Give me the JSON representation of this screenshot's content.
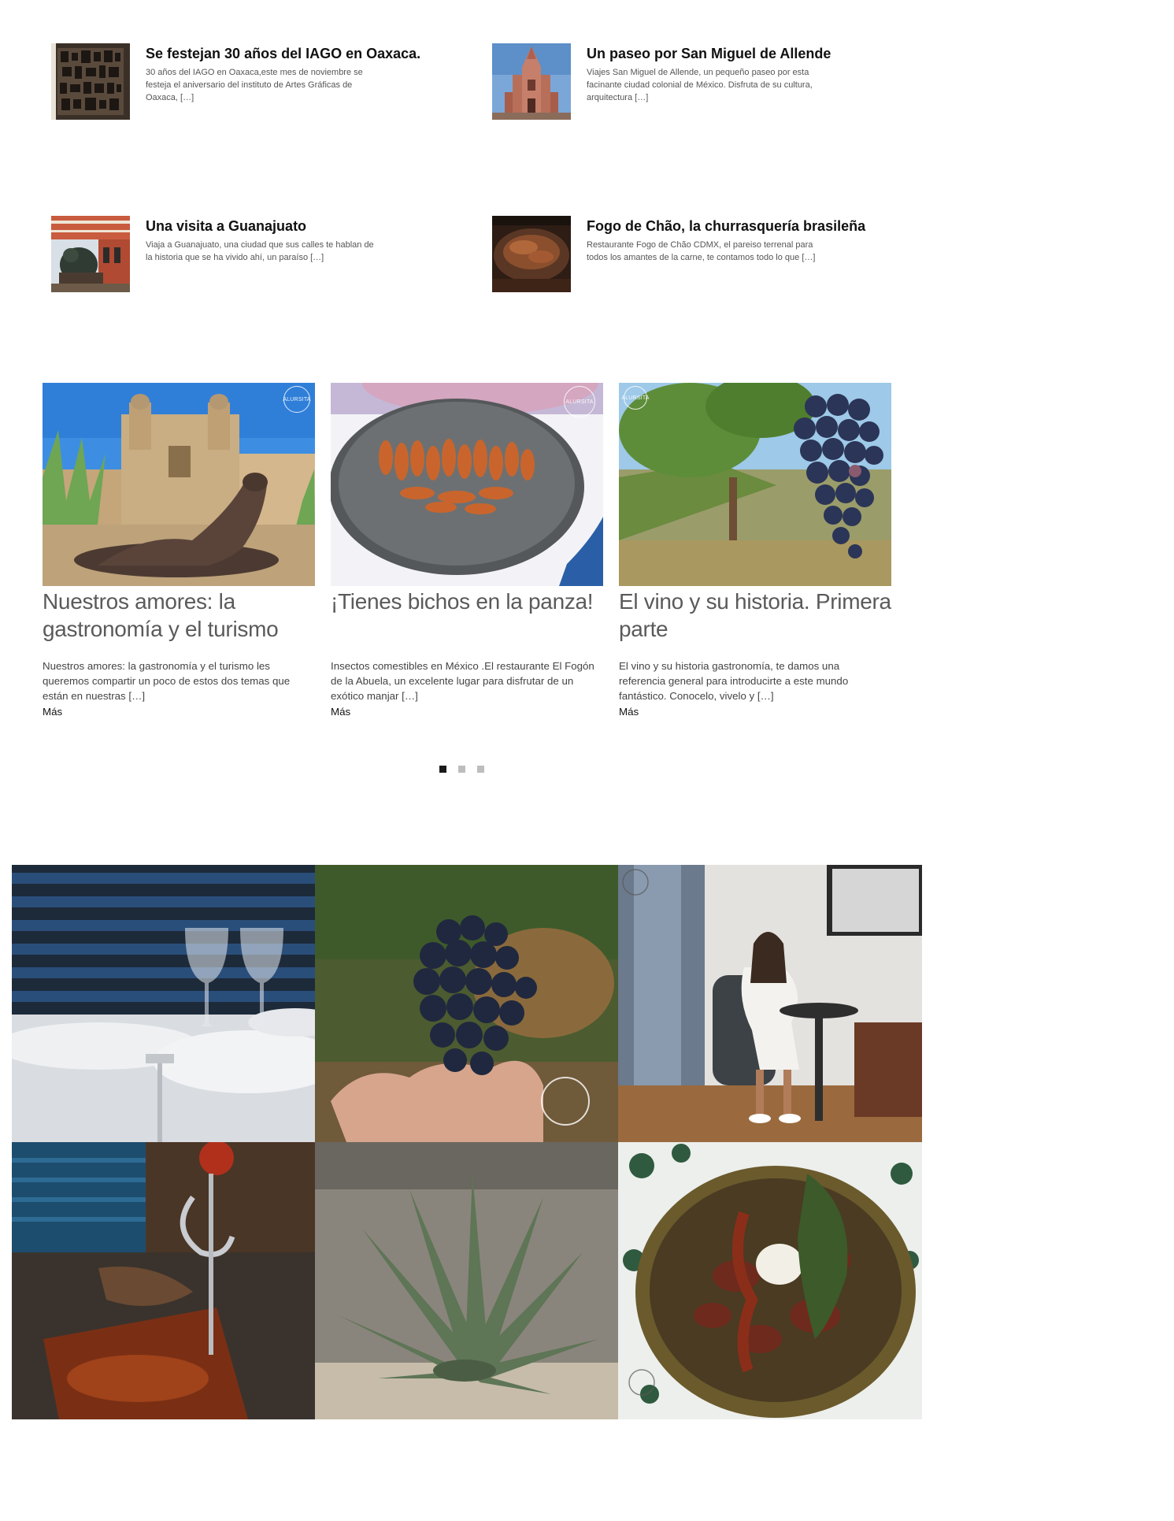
{
  "posts": [
    {
      "title": "Se festejan 30 años del IAGO en Oaxaca.",
      "excerpt": "30 años del IAGO en Oaxaca,este mes de noviembre se festeja el aniversario del instituto de Artes Gráficas de Oaxaca, […]"
    },
    {
      "title": "Un paseo por San Miguel de Allende",
      "excerpt": "Viajes San Miguel de Allende, un pequeño paseo por esta facinante ciudad colonial de México. Disfruta de su cultura, arquitectura […]"
    },
    {
      "title": "Una visita a Guanajuato",
      "excerpt": "Viaja a Guanajuato, una ciudad que sus calles te hablan de la historia que se ha vivido ahí, un paraíso […]"
    },
    {
      "title": "Fogo de Chão, la churrasquería brasileña",
      "excerpt": "Restaurante Fogo de Chão CDMX, el pareiso terrenal para todos los amantes de la carne, te contamos todo lo que […]"
    }
  ],
  "carousel": {
    "cards": [
      {
        "title": "Nuestros amores: la gastronomía y el turismo",
        "excerpt": "Nuestros amores: la gastronomía y el turismo les queremos compartir un poco de estos dos temas que están en nuestras […]",
        "more": "Más"
      },
      {
        "title": "¡Tienes bichos en la panza!",
        "excerpt": "Insectos comestibles en México .El restaurante El Fogón de la Abuela, un excelente lugar para disfrutar de un exótico manjar […]",
        "more": "Más"
      },
      {
        "title": "El vino y su historia. Primera parte",
        "excerpt": "El vino y su historia gastronomía, te damos una referencia general para introducirte a este mundo fantástico. Conocelo, vivelo y […]",
        "more": "Más"
      }
    ],
    "active_page": 1,
    "page_count": 3
  },
  "watermark": "ALURSITA",
  "gallery": {
    "items": [
      "restaurant-table",
      "grapes-in-hand",
      "woman-in-robe",
      "restaurant-ham",
      "agave-plant",
      "food-bowl"
    ]
  },
  "colors": {
    "title": "#111111",
    "card_title": "#5a5a5a",
    "dot_active": "#1a1a1a",
    "dot_inactive": "#bdbdbd"
  }
}
